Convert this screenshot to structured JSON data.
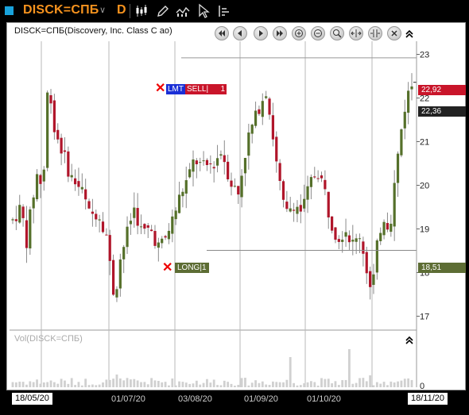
{
  "toolbar": {
    "symbol": "DISCK=СПБ",
    "interval": "D",
    "buttons": [
      "chart-type-icon",
      "draw-pencil-icon",
      "indicators-icon",
      "cursor-icon",
      "trade-panel-icon"
    ]
  },
  "chart": {
    "title": "DISCK=СПБ(Discovery, Inc. Class C ao)",
    "volume_title": "Vol(DISCK=СПБ)",
    "nav_buttons": [
      "scroll-start-icon",
      "scroll-left-icon",
      "scroll-right-icon",
      "scroll-end-icon",
      "zoom-in-icon",
      "zoom-out-icon",
      "zoom-box-icon",
      "fit-icon",
      "compress-icon",
      "close-icon"
    ]
  },
  "order": {
    "type": "LMT",
    "side": "SELL|",
    "qty": "1",
    "price_tag": "22,92"
  },
  "position": {
    "label": "LONG|1",
    "price_tag": "18,51"
  },
  "last_price": "22,36",
  "colors": {
    "up": "#55702a",
    "down": "#b0152a",
    "accent": "#f7931e",
    "sell": "#c9152a",
    "limit": "#1a2fd6",
    "long": "#5d6d34"
  },
  "chart_data": {
    "type": "candlestick",
    "y_ticks": [
      "17",
      "18",
      "19",
      "20",
      "21",
      "22",
      "23"
    ],
    "volume_ticks": [
      "0"
    ],
    "x_labels": [
      "01/07/20",
      "03/08/20",
      "01/09/20",
      "01/10/20"
    ],
    "start_date": "18/05/20",
    "end_date": "18/11/20",
    "ylim": [
      16.7,
      23.3
    ],
    "order_level": 22.92,
    "position_level": 18.51,
    "last_level": 22.36,
    "grid": true
  }
}
